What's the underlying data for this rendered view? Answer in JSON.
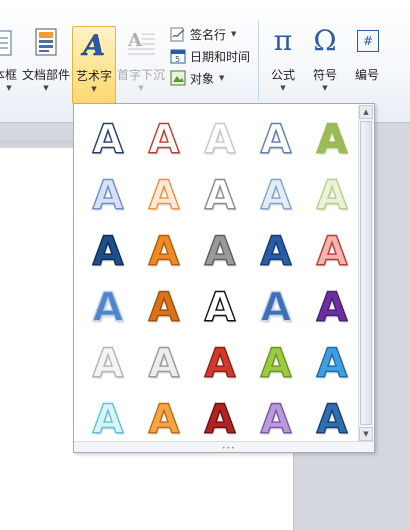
{
  "ribbon": {
    "buttons": [
      {
        "name": "text-box",
        "label": "本框"
      },
      {
        "name": "quick-parts",
        "label": "文档部件"
      },
      {
        "name": "wordart",
        "label": "艺术字"
      },
      {
        "name": "drop-cap",
        "label": "首字下沉"
      },
      {
        "name": "equation",
        "label": "公式"
      },
      {
        "name": "symbol",
        "label": "符号"
      },
      {
        "name": "number",
        "label": "编号"
      }
    ],
    "small": [
      {
        "name": "signature-line",
        "label": "签名行"
      },
      {
        "name": "date-time",
        "label": "日期和时间"
      },
      {
        "name": "object",
        "label": "对象"
      }
    ],
    "icons": {
      "equation": "π",
      "symbol": "Ω",
      "number": "#"
    }
  },
  "wordart_gallery": {
    "letter": "A",
    "styles": [
      {
        "fill": "#ffffff",
        "stroke": "#1f3d6e"
      },
      {
        "fill": "#ffffff",
        "stroke": "#c0392b"
      },
      {
        "fill": "#ffffff",
        "stroke": "#c8c8c8"
      },
      {
        "fill": "#ffffff",
        "stroke": "#5b7fb0"
      },
      {
        "fill": "#9bbb59",
        "stroke": "#9bbb59"
      },
      {
        "fill": "#d6e2f5",
        "stroke": "#6f8ccf"
      },
      {
        "fill": "#fde9d9",
        "stroke": "#f0923c"
      },
      {
        "fill": "#ffffff",
        "stroke": "#8a8a8a"
      },
      {
        "fill": "#e3ecf8",
        "stroke": "#7ea3d6"
      },
      {
        "fill": "#eaf2d8",
        "stroke": "#b9d08a"
      },
      {
        "fill": "#1f4e8c",
        "stroke": "#0e2d57"
      },
      {
        "fill": "#f08a24",
        "stroke": "#b35d0b"
      },
      {
        "fill": "#9a9a9a",
        "stroke": "#5f5f5f"
      },
      {
        "fill": "#2a5aa8",
        "stroke": "#173a74"
      },
      {
        "fill": "#f4b4b4",
        "stroke": "#c0392b"
      },
      {
        "fill": "#4e86c9",
        "stroke": "#bcd3ef"
      },
      {
        "fill": "#d9721a",
        "stroke": "#a24f0a"
      },
      {
        "fill": "#ffffff",
        "stroke": "#111111"
      },
      {
        "fill": "#3f6fb5",
        "stroke": "#c6d6ee"
      },
      {
        "fill": "#6b2fa0",
        "stroke": "#4a1f73"
      },
      {
        "fill": "#f5f5f5",
        "stroke": "#b5b5b5"
      },
      {
        "fill": "#ededed",
        "stroke": "#9a9a9a"
      },
      {
        "fill": "#d03a2c",
        "stroke": "#8f1f14"
      },
      {
        "fill": "#9ccb3f",
        "stroke": "#6c9428"
      },
      {
        "fill": "#3fa0e0",
        "stroke": "#1e6aa8"
      },
      {
        "fill": "#d9f3f7",
        "stroke": "#5cc3d8"
      },
      {
        "fill": "#f6a545",
        "stroke": "#c06c12"
      },
      {
        "fill": "#b22222",
        "stroke": "#6e1010"
      },
      {
        "fill": "#b99bd9",
        "stroke": "#7a56a8"
      },
      {
        "fill": "#2f6fb0",
        "stroke": "#163f6e"
      }
    ]
  }
}
